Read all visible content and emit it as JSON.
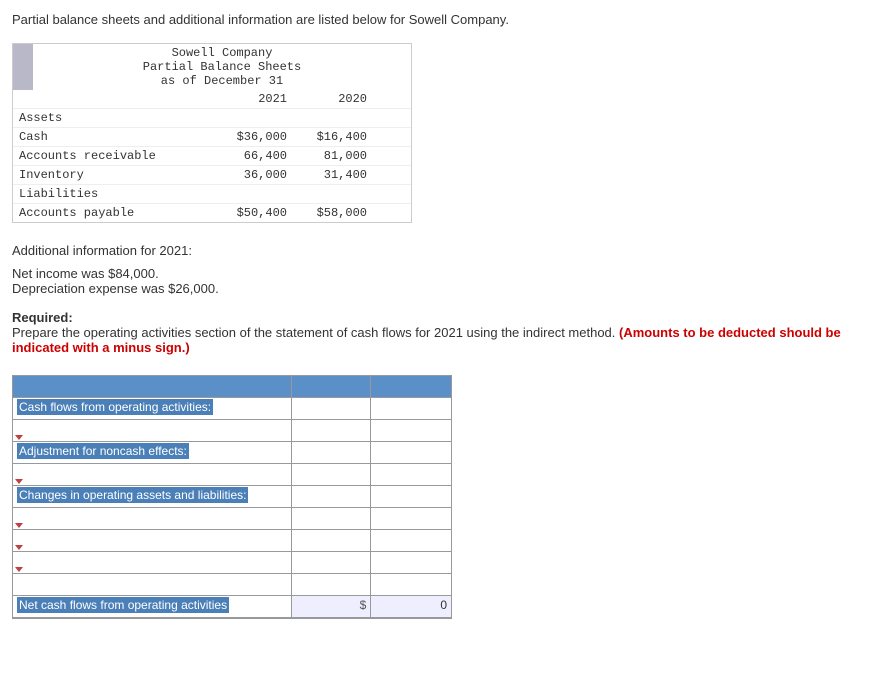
{
  "intro": "Partial balance sheets and additional information are listed below for Sowell Company.",
  "balanceSheet": {
    "company": "Sowell Company",
    "title": "Partial Balance Sheets",
    "asof": "as of December 31",
    "yearA": "2021",
    "yearB": "2020",
    "sections": {
      "assetsLabel": "Assets",
      "liabilitiesLabel": "Liabilities"
    },
    "rows": {
      "cash": {
        "label": "Cash",
        "a": "$36,000",
        "b": "$16,400"
      },
      "ar": {
        "label": "Accounts receivable",
        "a": "66,400",
        "b": "81,000"
      },
      "inv": {
        "label": "Inventory",
        "a": "36,000",
        "b": "31,400"
      },
      "ap": {
        "label": "Accounts payable",
        "a": "$50,400",
        "b": "$58,000"
      }
    }
  },
  "additional": {
    "heading": "Additional information for 2021:",
    "line1": "Net income was $84,000.",
    "line2": "Depreciation expense was $26,000."
  },
  "required": {
    "label": "Required:",
    "text": "Prepare the operating activities section of the statement of cash flows for 2021 using the indirect method. ",
    "redText": "(Amounts to be deducted should be indicated with a minus sign.)"
  },
  "worksheet": {
    "row1": "Cash flows from operating activities:",
    "row3": "Adjustment for noncash effects:",
    "row5": "Changes in operating assets and liabilities:",
    "rowLast": "Net cash flows from operating activities",
    "totalSym": "$",
    "totalVal": "0"
  }
}
